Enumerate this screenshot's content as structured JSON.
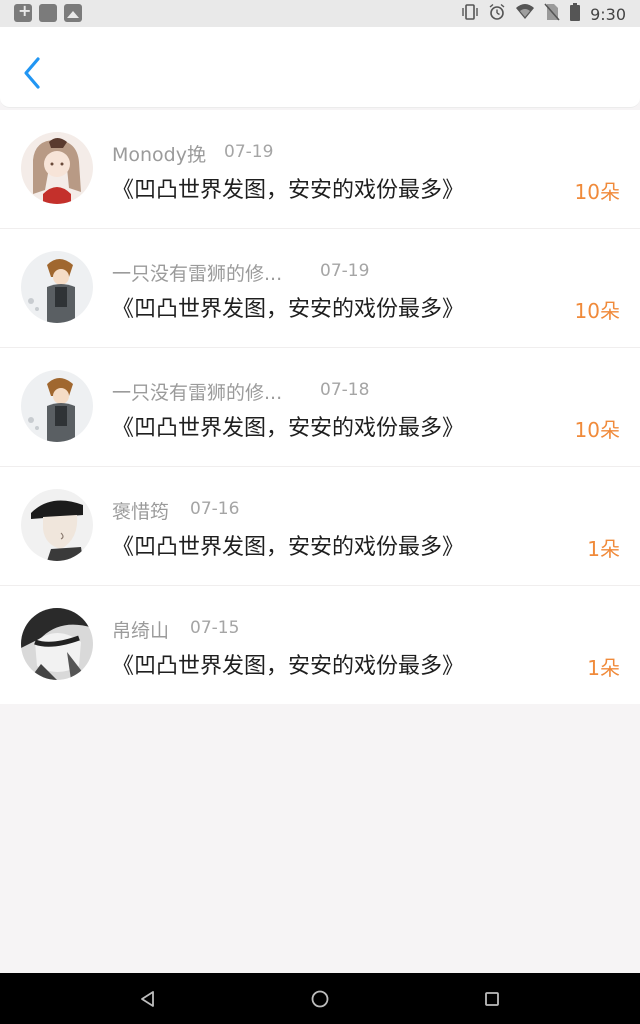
{
  "status_bar": {
    "time": "9:30",
    "left_icons": [
      "add-notification-icon",
      "app-notification-icon",
      "image-notification-icon"
    ],
    "right_icons": [
      "vibrate-icon",
      "alarm-icon",
      "wifi-icon",
      "no-sim-icon",
      "battery-icon"
    ]
  },
  "header": {
    "back_icon": "chevron-left-icon",
    "accent_color": "#2196f3"
  },
  "gift_list": [
    {
      "user": "Monody挽",
      "date": "07-19",
      "title": "《凹凸世界发图，安安的戏份最多》",
      "count": "10朵"
    },
    {
      "user": "一只没有雷狮的修...",
      "date": "07-19",
      "title": "《凹凸世界发图，安安的戏份最多》",
      "count": "10朵"
    },
    {
      "user": "一只没有雷狮的修...",
      "date": "07-18",
      "title": "《凹凸世界发图，安安的戏份最多》",
      "count": "10朵"
    },
    {
      "user": "褒惜筠",
      "date": "07-16",
      "title": "《凹凸世界发图，安安的戏份最多》",
      "count": "1朵"
    },
    {
      "user": "帛绮山",
      "date": "07-15",
      "title": "《凹凸世界发图，安安的戏份最多》",
      "count": "1朵"
    }
  ],
  "colors": {
    "count": "#f08a3a",
    "username": "#9b9b9b",
    "title": "#1f1f1f"
  },
  "nav_bar": {
    "icons": [
      "back-triangle-icon",
      "home-circle-icon",
      "recents-square-icon"
    ]
  }
}
